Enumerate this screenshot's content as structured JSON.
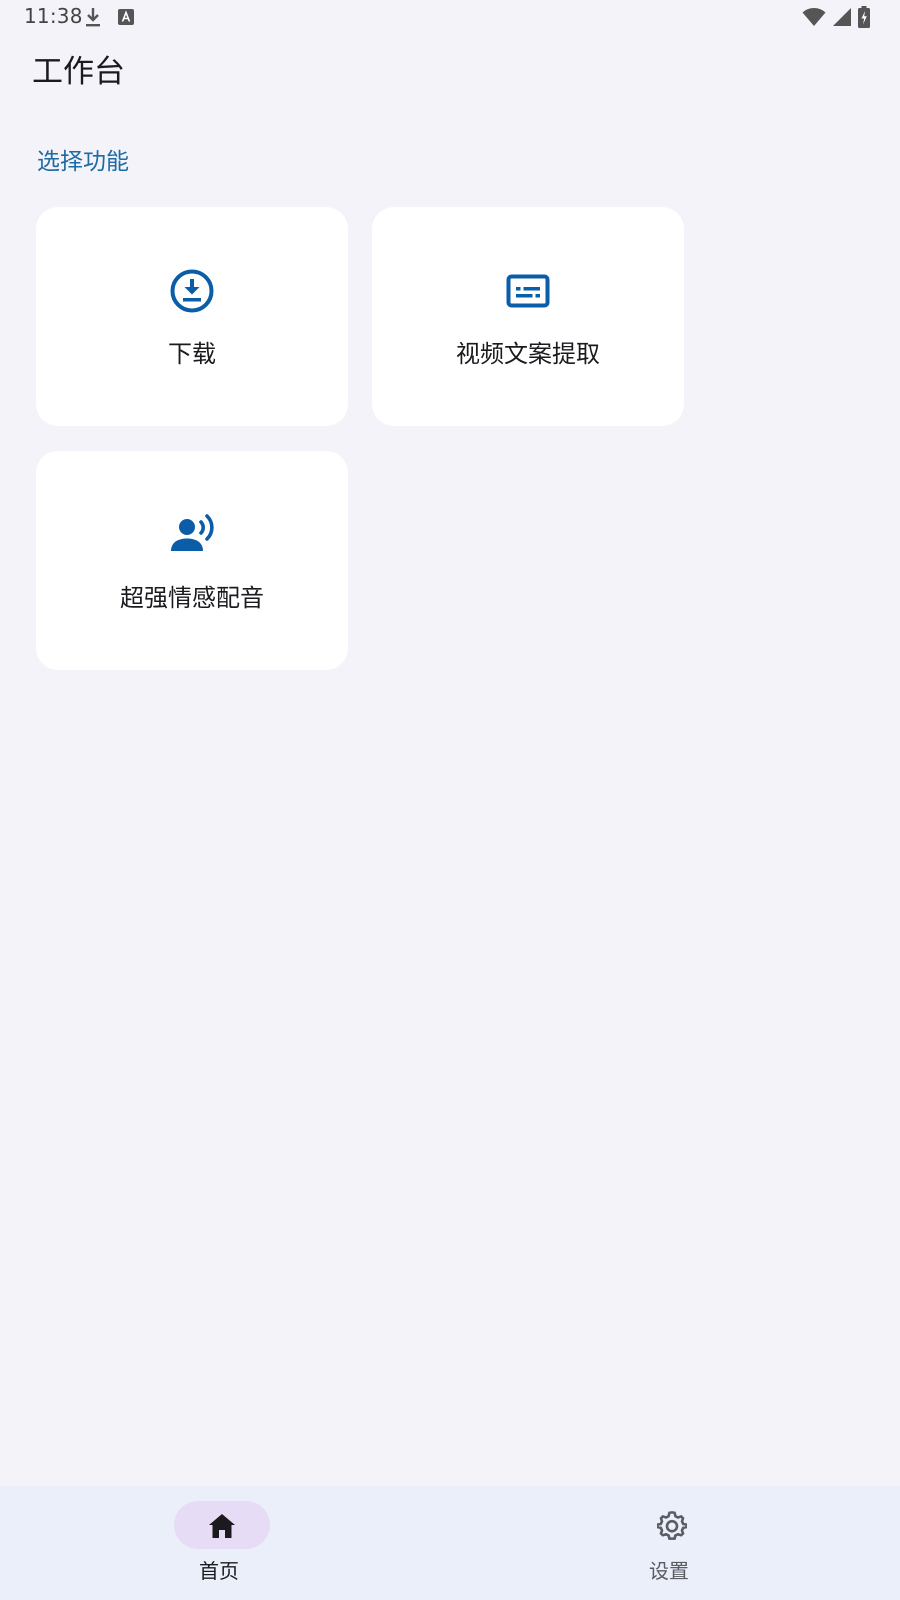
{
  "status_bar": {
    "time": "11:38",
    "icons": [
      "download-icon",
      "font-a-icon",
      "wifi-icon",
      "signal-icon",
      "battery-charging-icon"
    ]
  },
  "app_bar": {
    "title": "工作台"
  },
  "section": {
    "title": "选择功能"
  },
  "cards": [
    {
      "label": "下载",
      "icon": "download-circle-icon"
    },
    {
      "label": "视频文案提取",
      "icon": "subtitles-icon"
    },
    {
      "label": "超强情感配音",
      "icon": "record-voice-icon"
    }
  ],
  "bottom_nav": {
    "items": [
      {
        "label": "首页",
        "icon": "home-icon",
        "selected": true
      },
      {
        "label": "设置",
        "icon": "gear-icon",
        "selected": false
      }
    ]
  },
  "colors": {
    "background": "#f3f3f9",
    "card": "#ffffff",
    "accent": "#1e6aa4",
    "icon_blue": "#0b5da8",
    "nav_background": "#eaeff9",
    "nav_selected_pill": "#e7dcf6"
  }
}
